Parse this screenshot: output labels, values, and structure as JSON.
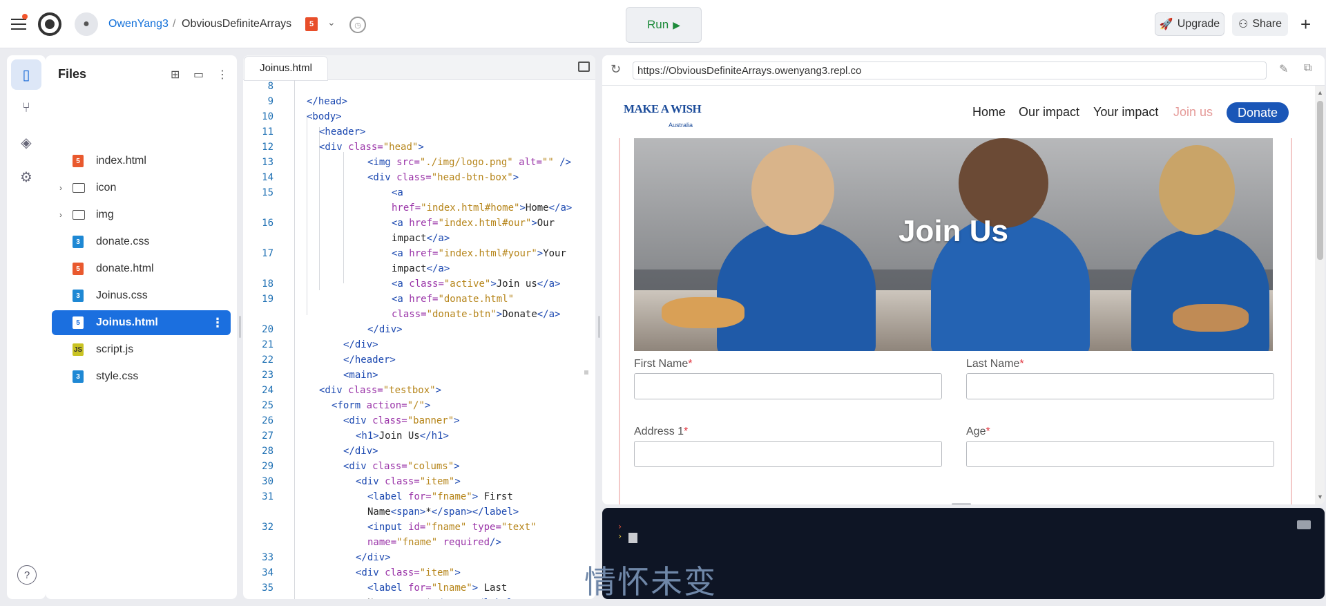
{
  "topbar": {
    "username": "OwenYang3",
    "separator": "/",
    "repl_name": "ObviousDefiniteArrays",
    "run_label": "Run",
    "upgrade_label": "Upgrade",
    "share_label": "Share"
  },
  "files": {
    "title": "Files",
    "items": [
      {
        "name": "index.html",
        "type": "html"
      },
      {
        "name": "icon",
        "type": "folder"
      },
      {
        "name": "img",
        "type": "folder"
      },
      {
        "name": "donate.css",
        "type": "css"
      },
      {
        "name": "donate.html",
        "type": "html"
      },
      {
        "name": "Joinus.css",
        "type": "css"
      },
      {
        "name": "Joinus.html",
        "type": "html",
        "selected": true
      },
      {
        "name": "script.js",
        "type": "js"
      },
      {
        "name": "style.css",
        "type": "css"
      }
    ]
  },
  "editor": {
    "tab_label": "Joinus.html",
    "line_numbers": [
      "8",
      "9",
      "10",
      "11",
      "12",
      "13",
      "14",
      "15",
      "16",
      "17",
      "18",
      "19",
      "20",
      "21",
      "22",
      "23",
      "24",
      "25",
      "26",
      "27",
      "28",
      "29",
      "30",
      "31",
      "32",
      "33",
      "34",
      "35"
    ]
  },
  "preview": {
    "url": "https://ObviousDefiniteArrays.owenyang3.repl.co",
    "logo_text": "MAKE A WISH",
    "logo_sub": "Australia",
    "nav": [
      "Home",
      "Our impact",
      "Your impact",
      "Join us",
      "Donate"
    ],
    "banner_title": "Join Us",
    "fields": [
      {
        "label": "First Name",
        "required": "*"
      },
      {
        "label": "Last Name",
        "required": "*"
      },
      {
        "label": "Address 1",
        "required": "*"
      },
      {
        "label": "Age",
        "required": "*"
      }
    ]
  },
  "overlay_text": "情怀未变",
  "colors": {
    "accent": "#1b6fdf",
    "run_green": "#1d8b3a",
    "donate_blue": "#1a56b7",
    "required_red": "#e0303a"
  }
}
